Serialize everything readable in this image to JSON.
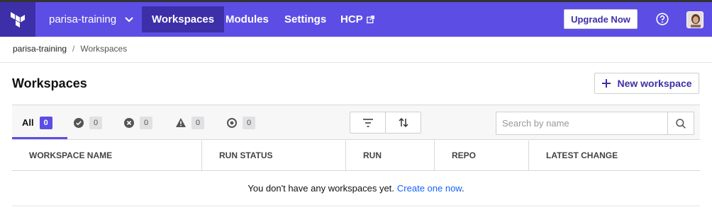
{
  "topbar": {
    "org_name": "parisa-training",
    "nav": [
      {
        "label": "Workspaces",
        "active": true
      },
      {
        "label": "Modules",
        "active": false
      },
      {
        "label": "Settings",
        "active": false
      },
      {
        "label": "HCP",
        "active": false
      }
    ],
    "upgrade_label": "Upgrade Now",
    "icons": {
      "logo": "terraform-logo-icon",
      "org_dropdown": "chevron-down-icon",
      "external": "external-link-icon",
      "help": "help-circle-icon"
    }
  },
  "breadcrumb": {
    "org": "parisa-training",
    "separator": "/",
    "current": "Workspaces"
  },
  "page": {
    "title": "Workspaces",
    "new_workspace_label": "New workspace"
  },
  "filters": {
    "tabs": [
      {
        "label": "All",
        "count": "0",
        "icon": "",
        "active": true
      },
      {
        "label": "",
        "count": "0",
        "icon": "check-circle-icon",
        "active": false
      },
      {
        "label": "",
        "count": "0",
        "icon": "x-circle-icon",
        "active": false
      },
      {
        "label": "",
        "count": "0",
        "icon": "warning-triangle-icon",
        "active": false
      },
      {
        "label": "",
        "count": "0",
        "icon": "pending-circle-icon",
        "active": false
      }
    ],
    "search_placeholder": "Search by name"
  },
  "table": {
    "columns": [
      "WORKSPACE NAME",
      "RUN STATUS",
      "RUN",
      "REPO",
      "LATEST CHANGE"
    ],
    "empty_text": "You don't have any workspaces yet.",
    "empty_link": "Create one now",
    "empty_suffix": "."
  },
  "colors": {
    "brand": "#5c4ee5",
    "brand_dark": "#3d2fa8",
    "link": "#1563ff"
  }
}
